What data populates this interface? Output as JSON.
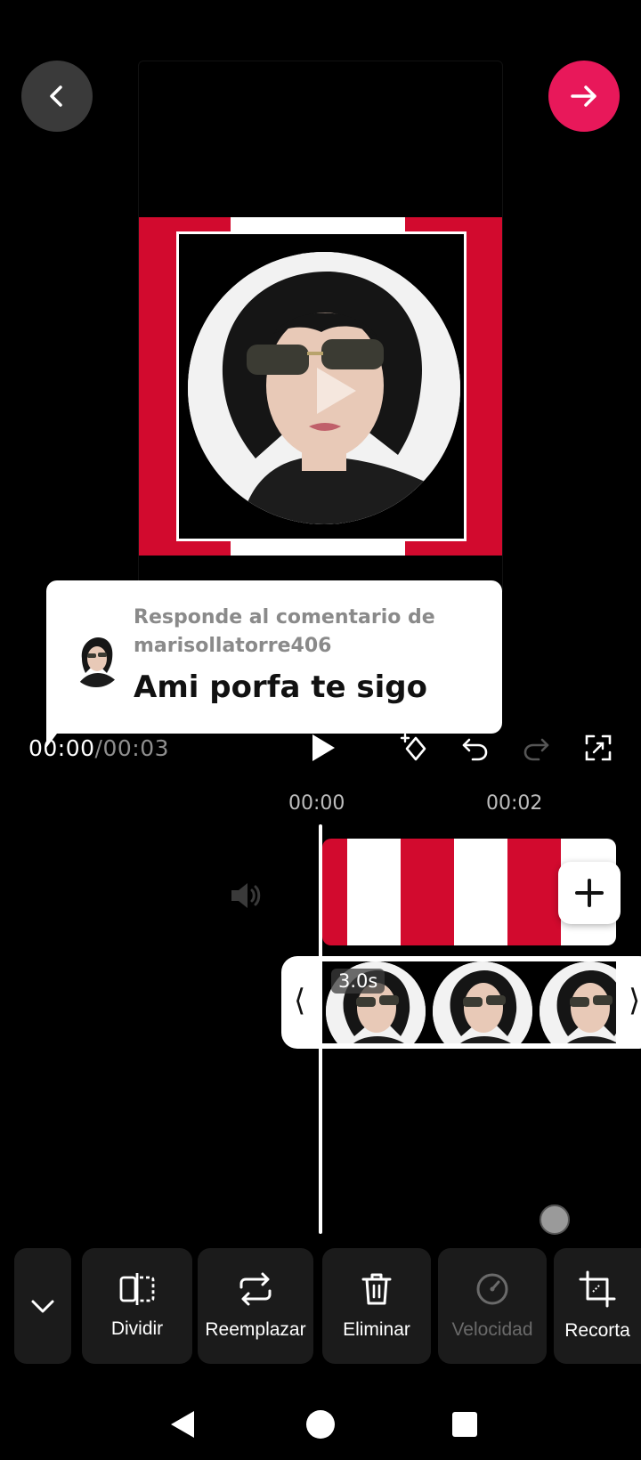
{
  "editor": {
    "back_icon": "chevron-left-icon",
    "next_icon": "arrow-right-icon",
    "accent": "#e8185a",
    "frame_color": "#d20a2e"
  },
  "comment": {
    "subtitle": "Responde al comentario de marisollatorre406",
    "text": "Ami porfa te sigo"
  },
  "playback": {
    "current": "00:00",
    "separator": "/",
    "total": "00:03",
    "play_icon": "play-icon",
    "keyframe_icon": "keyframe-add-icon",
    "undo_icon": "undo-icon",
    "redo_icon": "redo-icon",
    "fullscreen_icon": "fullscreen-icon"
  },
  "timeline": {
    "ruler": [
      "00:00",
      "00:02"
    ],
    "clip_duration": "3.0s",
    "add_icon": "plus-icon",
    "mute_icon": "speaker-icon"
  },
  "toolbar": {
    "collapse_icon": "chevron-down-icon",
    "items": [
      {
        "label": "Dividir",
        "icon": "split-icon",
        "enabled": true
      },
      {
        "label": "Reemplazar",
        "icon": "replace-icon",
        "enabled": true
      },
      {
        "label": "Eliminar",
        "icon": "trash-icon",
        "enabled": true
      },
      {
        "label": "Velocidad",
        "icon": "speed-icon",
        "enabled": false
      },
      {
        "label": "Recorta",
        "icon": "crop-icon",
        "enabled": true
      }
    ]
  },
  "system_nav": {
    "back_icon": "nav-back-icon",
    "home_icon": "nav-home-icon",
    "recents_icon": "nav-recents-icon"
  }
}
